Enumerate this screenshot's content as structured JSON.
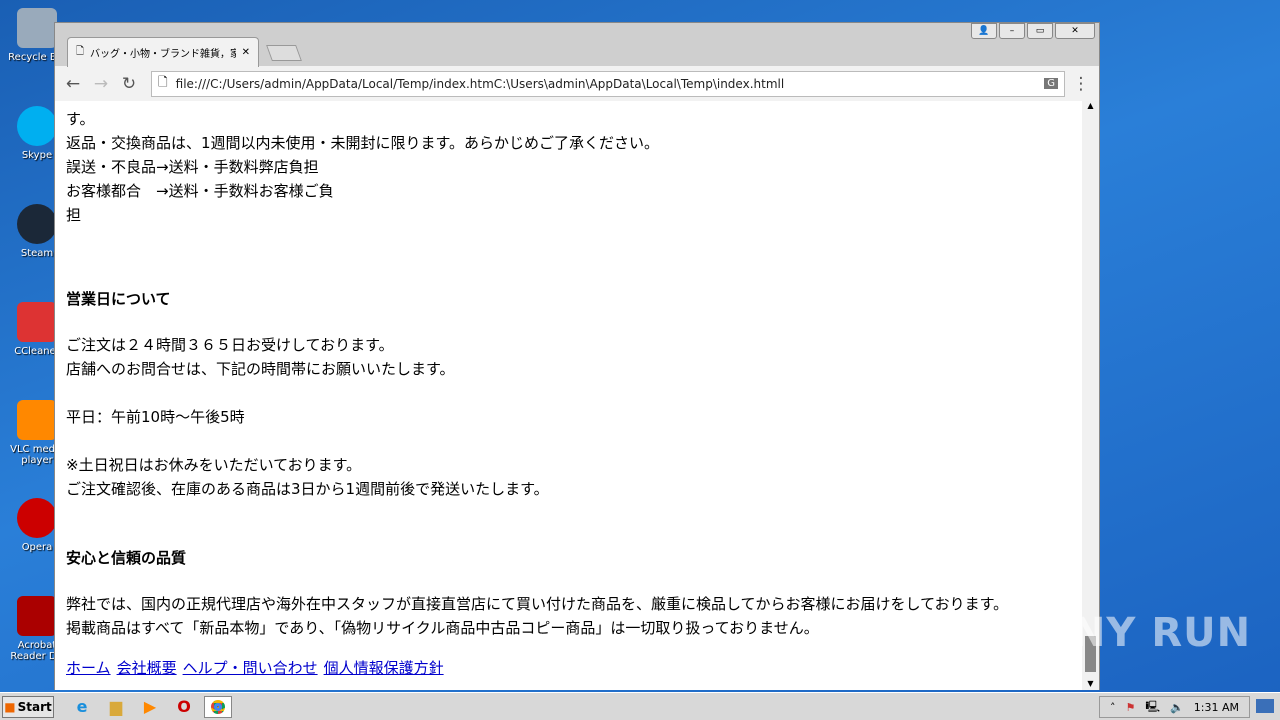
{
  "desktop": {
    "icons": [
      "Recycle Bin",
      "Skype",
      "Steam",
      "CCleaner",
      "VLC media player",
      "Opera",
      "Acrobat Reader DC"
    ]
  },
  "browser": {
    "tab_title": "バッグ・小物・ブランド雑貨，家電",
    "url": "file:///C:/Users/admin/AppData/Local/Temp/index.htmC:\\Users\\admin\\AppData\\Local\\Temp\\index.htmll"
  },
  "content": {
    "lines1": [
      "す。",
      "返品・交換商品は、1週間以内未使用・未開封に限ります。あらかじめご了承ください。",
      "誤送・不良品→送料・手数料弊店負担",
      "お客様都合　→送料・手数料お客様ご負",
      "担"
    ],
    "h_business": "営業日について",
    "lines2": [
      "ご注文は２４時間３６５日お受けしております。",
      "店舗へのお問合せは、下記の時間帯にお願いいたします。"
    ],
    "hours": "平日：午前10時～午後5時",
    "lines3": [
      "※土日祝日はお休みをいただいております。",
      "ご注文確認後、在庫のある商品は3日から1週間前後で発送いたします。"
    ],
    "h_quality": "安心と信頼の品質",
    "lines4": [
      "弊社では、国内の正規代理店や海外在中スタッフが直接直営店にて買い付けた商品を、厳重に検品してからお客様にお届けをしております。",
      "掲載商品はすべて「新品本物」であり、「偽物リサイクル商品中古品コピー商品」は一切取り扱っておりません。"
    ],
    "links": [
      "ホーム",
      "会社概要",
      "ヘルプ・問い合わせ",
      "個人情報保護方針"
    ]
  },
  "taskbar": {
    "start": "Start",
    "clock": "1:31 AM"
  },
  "watermark": "ANY RUN"
}
